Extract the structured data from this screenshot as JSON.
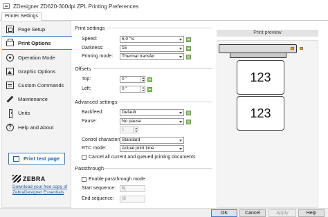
{
  "window": {
    "title": "ZDesigner ZD620-300dpi ZPL Printing Preferences"
  },
  "tabs": [
    {
      "label": "Printer Settings"
    }
  ],
  "sidebar": {
    "items": [
      {
        "label": "Page Setup",
        "icon": "page-setup-icon"
      },
      {
        "label": "Print Options",
        "icon": "printer-icon",
        "active": true
      },
      {
        "label": "Operation Mode",
        "icon": "operation-mode-icon"
      },
      {
        "label": "Graphic Options",
        "icon": "graphic-icon"
      },
      {
        "label": "Custom Commands",
        "icon": "custom-commands-icon"
      },
      {
        "label": "Maintenance",
        "icon": "wrench-icon"
      },
      {
        "label": "Units",
        "icon": "ruler-icon"
      },
      {
        "label": "Help and About",
        "icon": "help-icon"
      }
    ],
    "test_button": "Print test page",
    "brand": "ZEBRA",
    "link": "Download your free copy of ZebraDesigner Essentials"
  },
  "print_settings": {
    "section": "Print settings",
    "speed_label": "Speed:",
    "speed_value": "6.0 \"/s",
    "darkness_label": "Darkness:",
    "darkness_value": "15",
    "mode_label": "Printing mode:",
    "mode_value": "Thermal transfer"
  },
  "offsets": {
    "section": "Offsets",
    "top_label": "Top:",
    "top_value": "0 \"",
    "left_label": "Left:",
    "left_value": "0 \""
  },
  "advanced": {
    "section": "Advanced settings",
    "backfeed_label": "Backfeed:",
    "backfeed_value": "Default",
    "pause_label": "Pause:",
    "pause_value": "No pause",
    "pause_count": "1",
    "control_label": "Control characters:",
    "control_value": "Standard",
    "rtc_label": "RTC mode:",
    "rtc_value": "Actual print time",
    "cancel_label": "Cancel all current and queued printing documents"
  },
  "passthrough": {
    "section": "Passthrough",
    "enable_label": "Enable passthrough mode",
    "start_label": "Start sequence:",
    "start_value": "${",
    "end_label": "End sequence:",
    "end_value": "}$"
  },
  "preview": {
    "header": "Print preview",
    "label_text": "123"
  },
  "footer": {
    "ok": "OK",
    "cancel": "Cancel",
    "apply": "Apply",
    "help": "Help"
  }
}
